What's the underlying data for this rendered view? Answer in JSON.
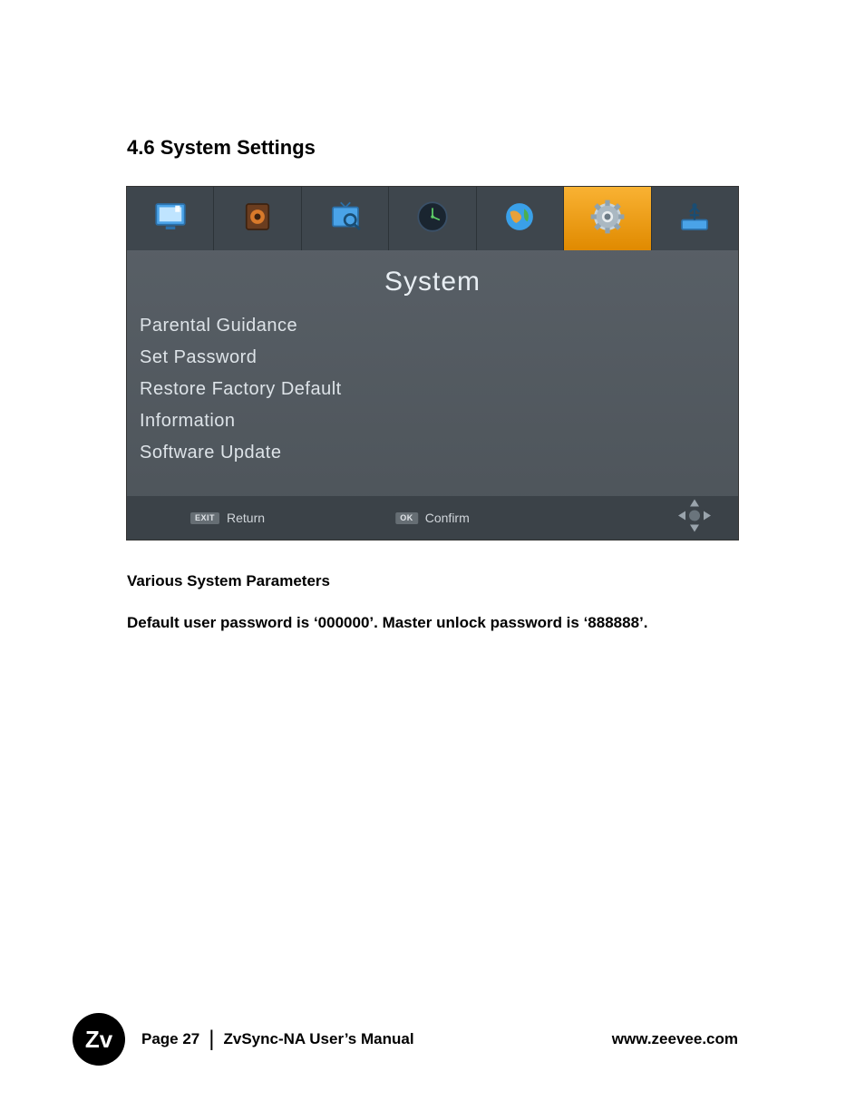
{
  "heading": "4.6  System Settings",
  "panel": {
    "title": "System",
    "tabs": [
      {
        "name": "picture",
        "selected": false
      },
      {
        "name": "sound",
        "selected": false
      },
      {
        "name": "channel",
        "selected": false
      },
      {
        "name": "time",
        "selected": false
      },
      {
        "name": "language",
        "selected": false
      },
      {
        "name": "system",
        "selected": true
      },
      {
        "name": "usb",
        "selected": false
      }
    ],
    "menu": [
      "Parental Guidance",
      "Set Password",
      "Restore Factory Default",
      "Information",
      "Software Update"
    ],
    "hints": {
      "exit_badge": "EXIT",
      "exit_label": "Return",
      "ok_badge": "OK",
      "ok_label": "Confirm"
    }
  },
  "caption_title": "Various System Parameters",
  "caption_body": "Default user password is ‘000000’.  Master unlock password is ‘888888’.",
  "footer": {
    "logo_text": "Zv",
    "page_label": "Page 27",
    "manual_title": "ZvSync-NA User’s Manual",
    "url": "www.zeevee.com"
  }
}
